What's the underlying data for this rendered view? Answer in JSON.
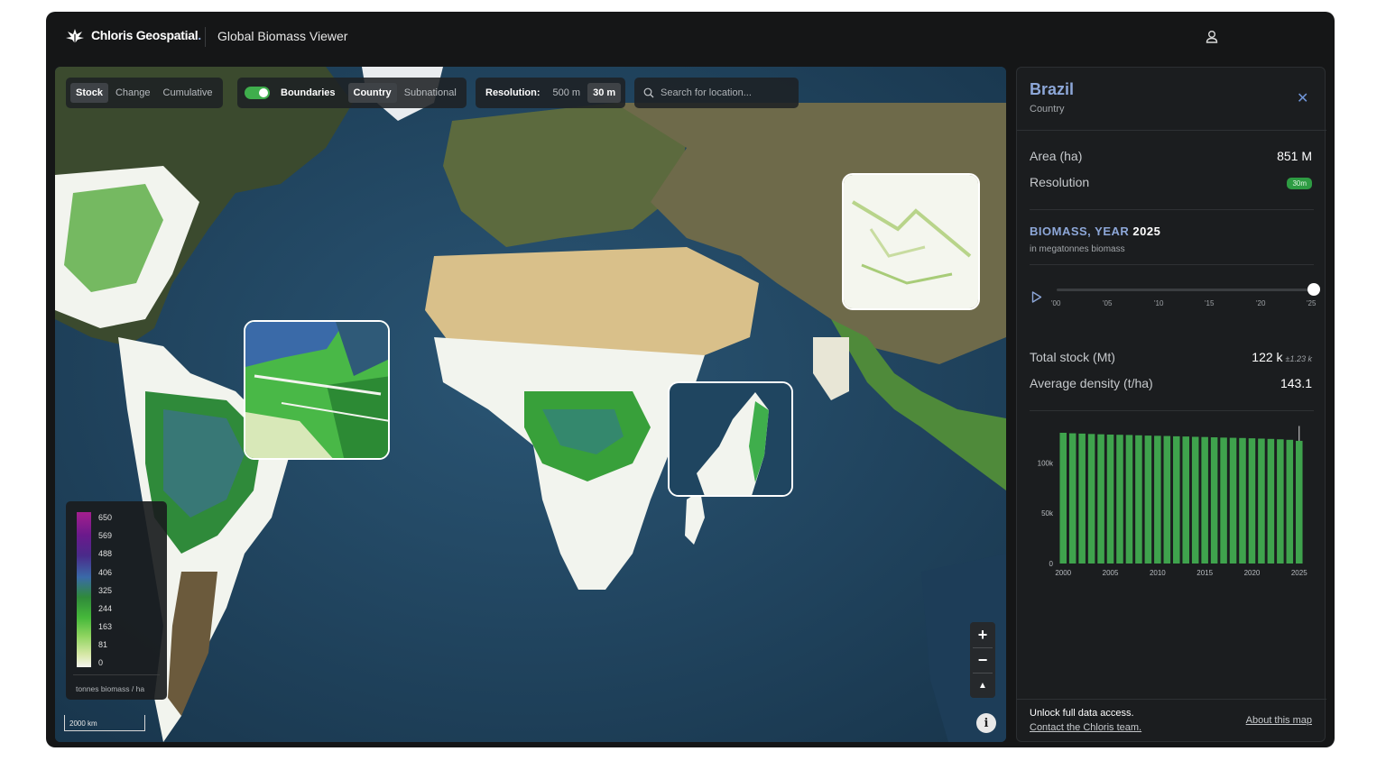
{
  "header": {
    "brand": "Chloris Geospatial",
    "brand_suffix": ".",
    "app_title": "Global Biomass Viewer"
  },
  "map_controls": {
    "mode_tabs": [
      "Stock",
      "Change",
      "Cumulative"
    ],
    "mode_active": "Stock",
    "boundaries_label": "Boundaries",
    "boundaries_on": true,
    "boundary_levels": [
      "Country",
      "Subnational"
    ],
    "boundary_active": "Country",
    "resolution_label": "Resolution:",
    "resolution_options": [
      "500 m",
      "30 m"
    ],
    "resolution_active": "30 m",
    "search_placeholder": "Search for location..."
  },
  "legend": {
    "ticks": [
      "650",
      "569",
      "488",
      "406",
      "325",
      "244",
      "163",
      "81",
      "0"
    ],
    "unit": "tonnes biomass / ha"
  },
  "scale_bar": "2000 km",
  "zoom": {
    "in": "+",
    "out": "−",
    "compass": "▲"
  },
  "info_icon": "i",
  "panel": {
    "title": "Brazil",
    "subtitle": "Country",
    "area_label": "Area (ha)",
    "area_value": "851 M",
    "resolution_label": "Resolution",
    "resolution_badge": "30m",
    "section_title": "BIOMASS, YEAR",
    "section_year": "2025",
    "section_sub": "in megatonnes biomass",
    "timeline_labels": [
      "'00",
      "'05",
      "'10",
      "'15",
      "'20",
      "'25"
    ],
    "timeline_position": 1.0,
    "total_stock_label": "Total stock (Mt)",
    "total_stock_value": "122 k",
    "total_stock_unc": "±1.23 k",
    "avg_density_label": "Average density (t/ha)",
    "avg_density_value": "143.1",
    "unlock_text": "Unlock full data access.",
    "contact_link": "Contact the Chloris team.",
    "about_link": "About this map"
  },
  "chart_data": {
    "type": "bar",
    "x": [
      2000,
      2001,
      2002,
      2003,
      2004,
      2005,
      2006,
      2007,
      2008,
      2009,
      2010,
      2011,
      2012,
      2013,
      2014,
      2015,
      2016,
      2017,
      2018,
      2019,
      2020,
      2021,
      2022,
      2023,
      2024,
      2025
    ],
    "values": [
      130000,
      129500,
      129200,
      128800,
      128500,
      128200,
      128000,
      127800,
      127500,
      127200,
      127000,
      126800,
      126500,
      126300,
      126000,
      125800,
      125500,
      125200,
      125000,
      124800,
      124500,
      124200,
      123900,
      123500,
      123000,
      122000
    ],
    "error_2025": 1230,
    "x_tick_labels": [
      "2000",
      "2005",
      "2010",
      "2015",
      "2020",
      "2025"
    ],
    "y_tick_labels": [
      "0",
      "50k",
      "100k"
    ],
    "ylim": [
      0,
      130000
    ],
    "color": "#3fa34d"
  }
}
